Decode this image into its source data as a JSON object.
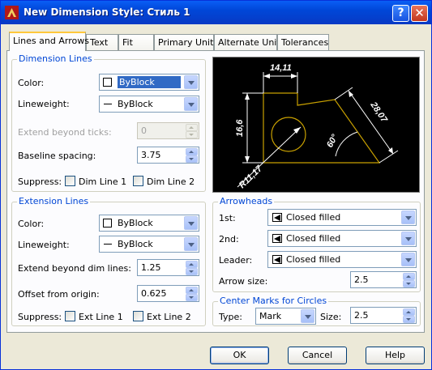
{
  "window": {
    "title": "New Dimension Style: Стиль 1",
    "help_glyph": "?",
    "close_glyph": "✕"
  },
  "tabs": [
    {
      "label": "Lines and Arrows",
      "active": true
    },
    {
      "label": "Text",
      "active": false
    },
    {
      "label": "Fit",
      "active": false
    },
    {
      "label": "Primary Units",
      "active": false
    },
    {
      "label": "Alternate Units",
      "active": false
    },
    {
      "label": "Tolerances",
      "active": false
    }
  ],
  "dimension_lines": {
    "group_title": "Dimension Lines",
    "color_label": "Color:",
    "color_value": "ByBlock",
    "lineweight_label": "Lineweight:",
    "lineweight_value": "ByBlock",
    "extend_label": "Extend beyond ticks:",
    "extend_value": "0",
    "baseline_label": "Baseline spacing:",
    "baseline_value": "3.75",
    "suppress_label": "Suppress:",
    "dim1_label": "Dim Line 1",
    "dim2_label": "Dim Line 2"
  },
  "extension_lines": {
    "group_title": "Extension Lines",
    "color_label": "Color:",
    "color_value": "ByBlock",
    "lineweight_label": "Lineweight:",
    "lineweight_value": "ByBlock",
    "extend_label": "Extend beyond dim lines:",
    "extend_value": "1.25",
    "offset_label": "Offset from origin:",
    "offset_value": "0.625",
    "suppress_label": "Suppress:",
    "ext1_label": "Ext Line 1",
    "ext2_label": "Ext Line 2"
  },
  "preview": {
    "dim_top": "14,11",
    "dim_left": "16,6",
    "dim_right": "28,07",
    "dim_angle": "60°",
    "dim_radius": "R11,17",
    "colors": {
      "background": "#000000",
      "geometry": "#c8a000",
      "dims": "#ffffff"
    }
  },
  "arrowheads": {
    "group_title": "Arrowheads",
    "first_label": "1st:",
    "first_value": "Closed filled",
    "second_label": "2nd:",
    "second_value": "Closed filled",
    "leader_label": "Leader:",
    "leader_value": "Closed filled",
    "size_label": "Arrow size:",
    "size_value": "2.5"
  },
  "center_marks": {
    "group_title": "Center Marks for Circles",
    "type_label": "Type:",
    "type_value": "Mark",
    "size_label": "Size:",
    "size_value": "2.5"
  },
  "buttons": {
    "ok": "OK",
    "cancel": "Cancel",
    "help": "Help"
  },
  "colors": {
    "titlebar": "#0a5ef5",
    "group_title": "#0046d5",
    "selection": "#316ac5",
    "tab_accent": "#ffc83c"
  }
}
